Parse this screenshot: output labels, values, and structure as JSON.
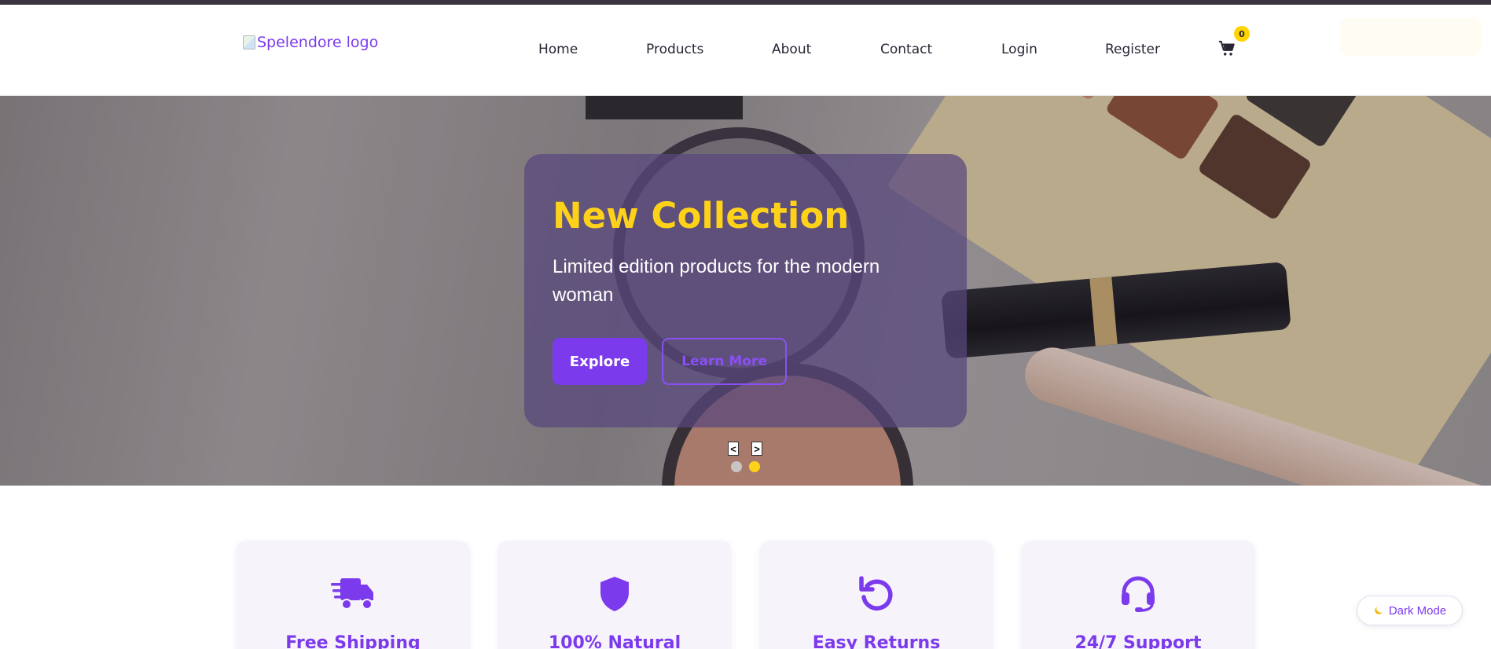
{
  "header": {
    "logo_alt": "Spelendore logo",
    "nav": [
      {
        "label": "Home"
      },
      {
        "label": "Products"
      },
      {
        "label": "About"
      },
      {
        "label": "Contact"
      },
      {
        "label": "Login"
      },
      {
        "label": "Register"
      }
    ],
    "cart_count": "0",
    "cart_icon": "shopping-cart-icon"
  },
  "hero": {
    "title": "New Collection",
    "subtitle": "Limited edition products for the modern woman",
    "explore_label": "Explore",
    "learn_more_label": "Learn More",
    "prev_glyph": "<",
    "next_glyph": ">",
    "slides_count": 2,
    "active_slide": 2
  },
  "features": [
    {
      "title": "Free Shipping",
      "icon": "truck-fast-icon"
    },
    {
      "title": "100% Natural",
      "icon": "shield-icon"
    },
    {
      "title": "Easy Returns",
      "icon": "rotate-left-icon"
    },
    {
      "title": "24/7 Support",
      "icon": "headset-icon"
    }
  ],
  "dark_mode": {
    "label": "Dark Mode",
    "icon": "moon-icon"
  },
  "colors": {
    "accent": "#7c3aed",
    "highlight": "#ffd21a",
    "badge": "#ffd400",
    "card_bg": "#f6f3fb"
  }
}
